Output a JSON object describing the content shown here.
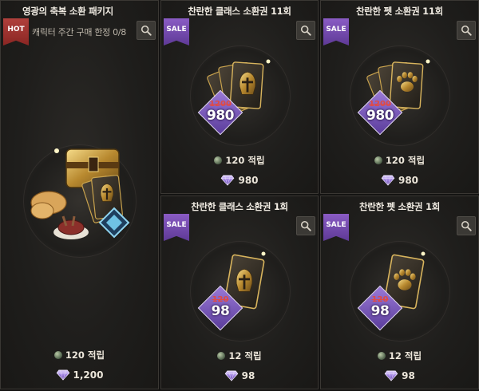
{
  "shop": {
    "colors": {
      "hot_ribbon": "#b0403c",
      "sale_ribbon": "#8a5cc4",
      "old_price": "#e14a44",
      "card_bg": "#1f1e1c"
    },
    "products": [
      {
        "title": "영광의 축복 소환 패키지",
        "tag": "HOT",
        "subtitle": "캐릭터 주간 구매 한정 0/8",
        "mileage": "120 적립",
        "price": "1,200",
        "icon": "chest-package-icon"
      },
      {
        "title": "찬란한 클래스 소환권 11회",
        "tag": "SALE",
        "old_price": "1200",
        "new_price": "980",
        "mileage": "120 적립",
        "price": "980",
        "icon": "class-card-bundle-icon"
      },
      {
        "title": "찬란한 펫 소환권 11회",
        "tag": "SALE",
        "old_price": "1200",
        "new_price": "980",
        "mileage": "120 적립",
        "price": "980",
        "icon": "pet-card-bundle-icon"
      },
      {
        "title": "찬란한 클래스 소환권 1회",
        "tag": "SALE",
        "old_price": "120",
        "new_price": "98",
        "mileage": "12 적립",
        "price": "98",
        "icon": "class-card-icon"
      },
      {
        "title": "찬란한 펫 소환권 1회",
        "tag": "SALE",
        "old_price": "120",
        "new_price": "98",
        "mileage": "12 적립",
        "price": "98",
        "icon": "pet-card-icon"
      }
    ]
  }
}
